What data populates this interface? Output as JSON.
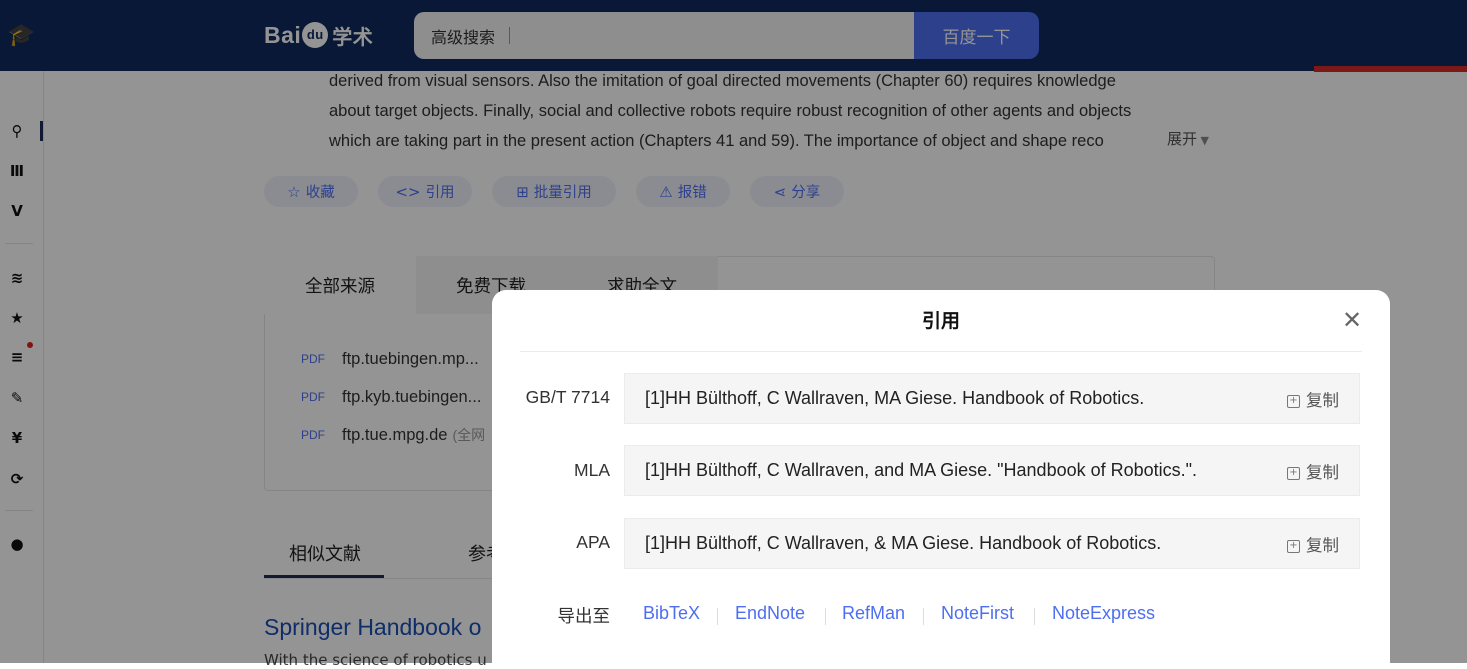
{
  "header": {
    "brand": {
      "bai": "Bai",
      "du": "du",
      "xueshu": "学术"
    },
    "search": {
      "advanced_label": "高级搜索",
      "button_label": "百度一下"
    }
  },
  "abstract": {
    "lines": [
      "derived from visual sensors. Also the imitation of goal directed movements (Chapter 60) requires knowledge",
      "about target objects. Finally, social and collective robots require robust recognition of other agents and objects",
      "which are taking part in the present action (Chapters 41 and 59). The importance of object and shape reco"
    ],
    "expand_label": "展开"
  },
  "actions": [
    {
      "icon": "star-outline-icon",
      "glyph": "☆",
      "label": "收藏"
    },
    {
      "icon": "code-icon",
      "glyph": "<>",
      "label": "引用"
    },
    {
      "icon": "batch-cite-icon",
      "glyph": "⊞",
      "label": "批量引用"
    },
    {
      "icon": "warning-icon",
      "glyph": "⚠",
      "label": "报错"
    },
    {
      "icon": "share-icon",
      "glyph": "⋖",
      "label": "分享"
    }
  ],
  "sources": {
    "tabs": [
      "全部来源",
      "免费下载",
      "求助全文"
    ],
    "rows": [
      {
        "type": "PDF",
        "name": "ftp.tuebingen.mp..."
      },
      {
        "type": "PDF",
        "name": "ftp.kyb.tuebingen..."
      },
      {
        "type": "PDF",
        "name": "ftp.tue.mpg.de",
        "extra": "(全网"
      }
    ]
  },
  "related": {
    "tab_similar": "相似文献",
    "tab_refs": "参考",
    "first_title": "Springer Handbook o",
    "first_sub": "With the science of robotics u"
  },
  "modal": {
    "title": "引用",
    "citations": [
      {
        "label": "GB/T 7714",
        "text": "[1]HH Bülthoff, C Wallraven, MA Giese. Handbook of Robotics.",
        "copy": "复制"
      },
      {
        "label": "MLA",
        "text": "[1]HH Bülthoff, C Wallraven, and MA Giese. \"Handbook of Robotics.\".",
        "copy": "复制"
      },
      {
        "label": "APA",
        "text": "[1]HH Bülthoff, C Wallraven, & MA Giese. Handbook of Robotics.",
        "copy": "复制"
      }
    ],
    "export": {
      "label": "导出至",
      "targets": [
        "BibTeX",
        "EndNote",
        "RefMan",
        "NoteFirst",
        "NoteExpress"
      ]
    }
  },
  "colors": {
    "header_bg": "#0e2a5e",
    "accent": "#4e6ef2",
    "overlay": "rgba(0,0,0,0.42)"
  }
}
